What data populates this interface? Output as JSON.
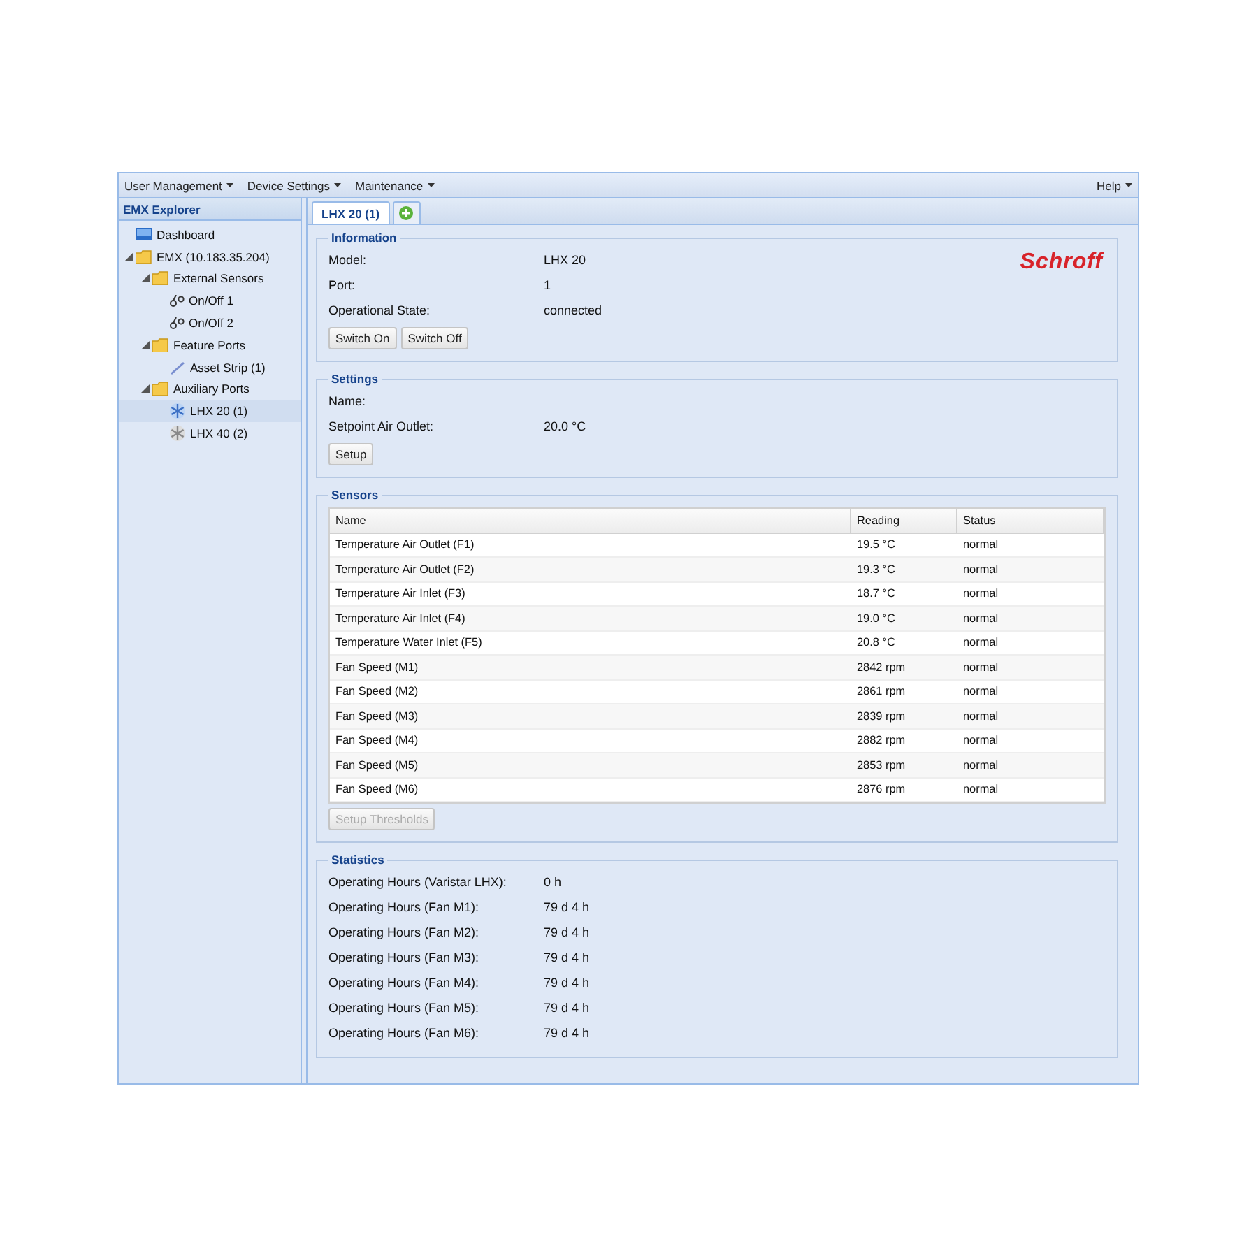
{
  "menu": {
    "items": [
      {
        "label": "User Management"
      },
      {
        "label": "Device Settings"
      },
      {
        "label": "Maintenance"
      }
    ],
    "help": {
      "label": "Help"
    }
  },
  "sidebar": {
    "title": "EMX Explorer",
    "items": [
      {
        "label": "Dashboard",
        "kind": "dashboard",
        "selected": false
      },
      {
        "label": "EMX (10.183.35.204)",
        "kind": "folder",
        "expanded": true,
        "selected": false,
        "children": [
          {
            "label": "External Sensors",
            "kind": "folder",
            "expanded": true,
            "selected": false,
            "children": [
              {
                "label": "On/Off 1",
                "kind": "sensor",
                "selected": false
              },
              {
                "label": "On/Off 2",
                "kind": "sensor",
                "selected": false
              }
            ]
          },
          {
            "label": "Feature Ports",
            "kind": "folder",
            "expanded": true,
            "selected": false,
            "children": [
              {
                "label": "Asset Strip (1)",
                "kind": "strip",
                "selected": false
              }
            ]
          },
          {
            "label": "Auxiliary Ports",
            "kind": "folder",
            "expanded": true,
            "selected": false,
            "children": [
              {
                "label": "LHX 20 (1)",
                "kind": "lhx_active",
                "selected": true
              },
              {
                "label": "LHX 40 (2)",
                "kind": "lhx_inactive",
                "selected": false
              }
            ]
          }
        ]
      }
    ]
  },
  "tabs": [
    {
      "label": "LHX 20 (1)",
      "selected": true
    }
  ],
  "information": {
    "title": "Information",
    "logo": "Schroff",
    "fields": [
      {
        "label": "Model:",
        "value": "LHX 20"
      },
      {
        "label": "Port:",
        "value": "1"
      },
      {
        "label": "Operational State:",
        "value": "connected"
      }
    ],
    "buttons": [
      {
        "label": "Switch On",
        "disabled": false
      },
      {
        "label": "Switch Off",
        "disabled": false
      }
    ]
  },
  "settings": {
    "title": "Settings",
    "fields": [
      {
        "label": "Name:"
      },
      {
        "label": "Setpoint Air Outlet:",
        "value": "20.0 °C"
      }
    ],
    "buttons": [
      {
        "label": "Setup",
        "disabled": false
      }
    ]
  },
  "sensors": {
    "title": "Sensors",
    "columns": [
      "Name",
      "Reading",
      "Status"
    ],
    "rows": [
      [
        "Temperature Air Outlet (F1)",
        "19.5 °C",
        "normal"
      ],
      [
        "Temperature Air Outlet (F2)",
        "19.3 °C",
        "normal"
      ],
      [
        "Temperature Air Inlet (F3)",
        "18.7 °C",
        "normal"
      ],
      [
        "Temperature Air Inlet (F4)",
        "19.0 °C",
        "normal"
      ],
      [
        "Temperature Water Inlet (F5)",
        "20.8 °C",
        "normal"
      ],
      [
        "Fan Speed (M1)",
        "2842 rpm",
        "normal"
      ],
      [
        "Fan Speed (M2)",
        "2861 rpm",
        "normal"
      ],
      [
        "Fan Speed (M3)",
        "2839 rpm",
        "normal"
      ],
      [
        "Fan Speed (M4)",
        "2882 rpm",
        "normal"
      ],
      [
        "Fan Speed (M5)",
        "2853 rpm",
        "normal"
      ],
      [
        "Fan Speed (M6)",
        "2876 rpm",
        "normal"
      ]
    ],
    "buttons": [
      {
        "label": "Setup Thresholds",
        "disabled": true
      }
    ]
  },
  "statistics": {
    "title": "Statistics",
    "fields": [
      {
        "label": "Operating Hours (Varistar LHX):",
        "value": "0 h"
      },
      {
        "label": "Operating Hours (Fan M1):",
        "value": "79 d 4 h"
      },
      {
        "label": "Operating Hours (Fan M2):",
        "value": "79 d 4 h"
      },
      {
        "label": "Operating Hours (Fan M3):",
        "value": "79 d 4 h"
      },
      {
        "label": "Operating Hours (Fan M4):",
        "value": "79 d 4 h"
      },
      {
        "label": "Operating Hours (Fan M5):",
        "value": "79 d 4 h"
      },
      {
        "label": "Operating Hours (Fan M6):",
        "value": "79 d 4 h"
      }
    ]
  }
}
